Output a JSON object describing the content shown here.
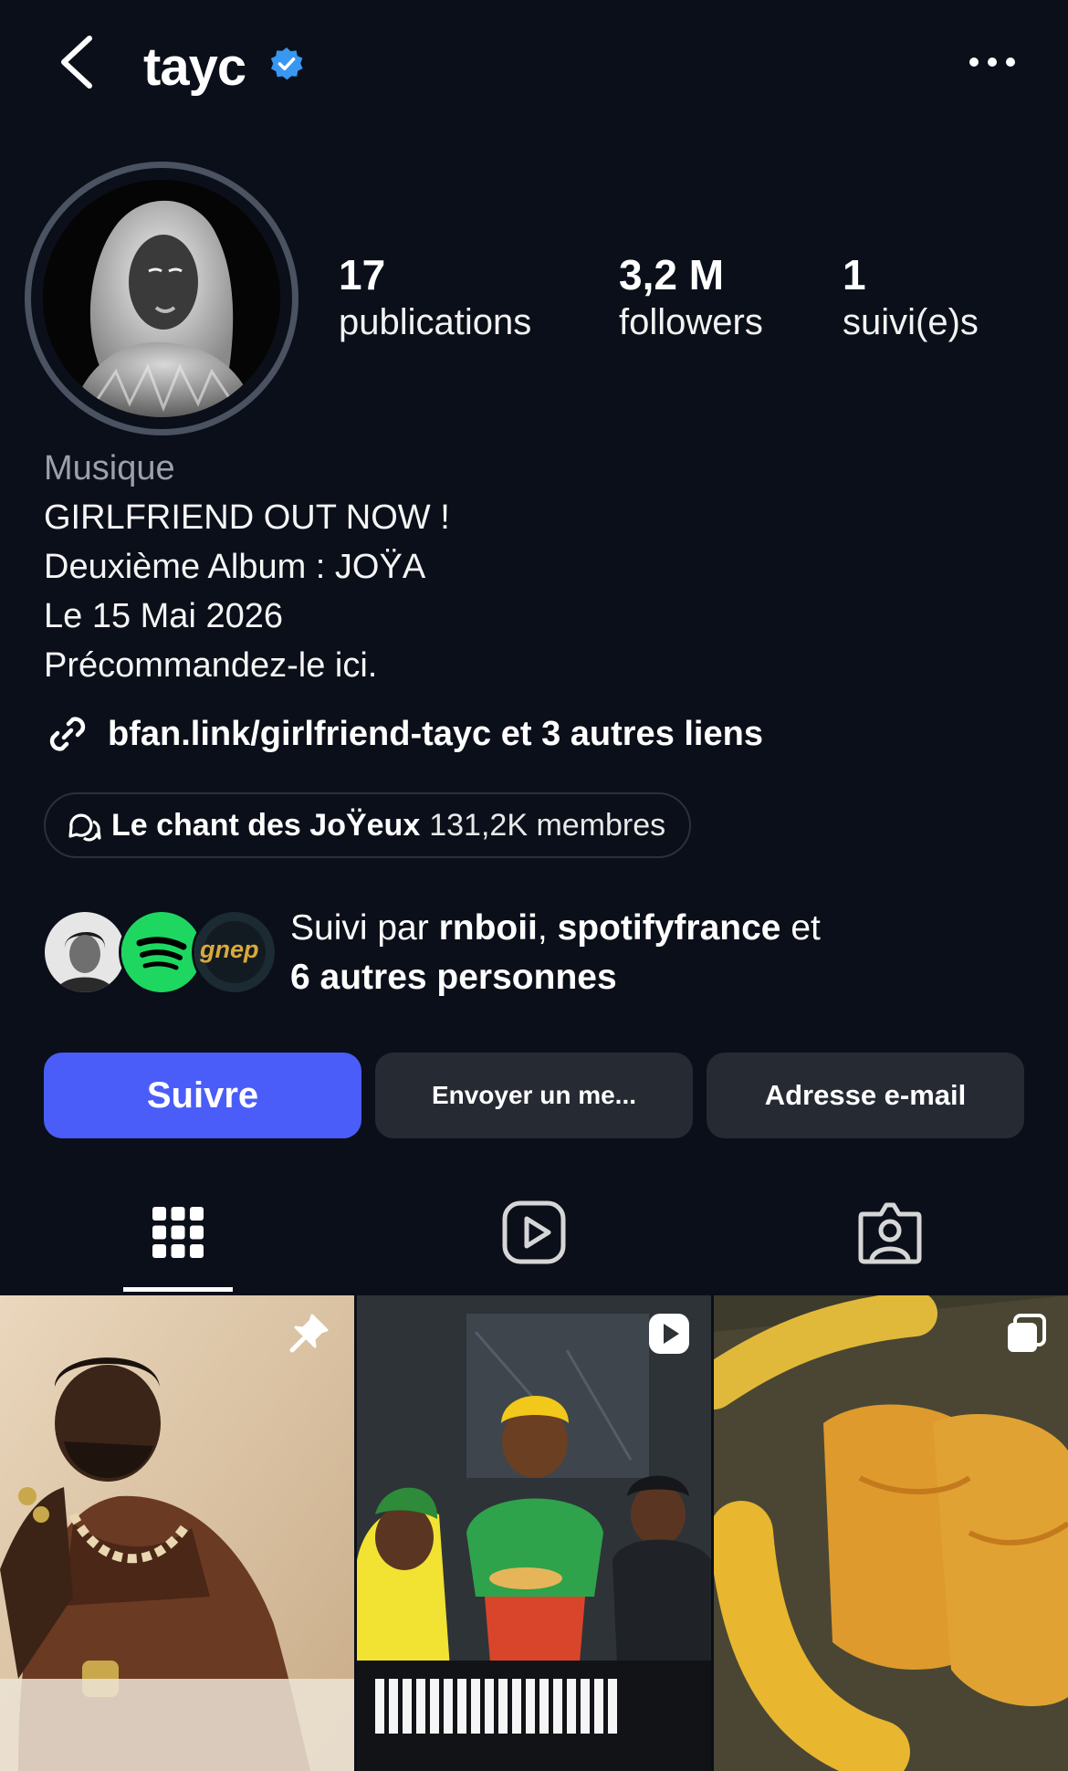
{
  "header": {
    "username": "tayc",
    "icons": {
      "back": "chevron-left-icon",
      "verified": "verified-badge-icon",
      "more": "more-horizontal-icon"
    }
  },
  "stats": [
    {
      "value": "17",
      "label": "publications"
    },
    {
      "value": "3,2 M",
      "label": "followers"
    },
    {
      "value": "1",
      "label": "suivi(e)s"
    }
  ],
  "bio": {
    "category": "Musique",
    "lines": [
      "GIRLFRIEND OUT NOW !",
      "Deuxième Album : JOŸA",
      "Le 15 Mai 2026",
      "Précommandez-le ici."
    ],
    "link_text": "bfan.link/girlfriend-tayc et 3 autres liens"
  },
  "channel": {
    "name": "Le chant des JoŸeux",
    "members": "131,2K membres"
  },
  "followed_by": {
    "prefix": "Suivi par ",
    "user1": "rnboii",
    "sep": ", ",
    "user2": "spotifyfrance",
    "suffix": " et",
    "others": "6 autres personnes",
    "avatar3_text": "gnep"
  },
  "buttons": {
    "follow": "Suivre",
    "message": "Envoyer un me...",
    "email": "Adresse e-mail"
  },
  "tabs": [
    "posts-grid",
    "reels",
    "tagged"
  ],
  "accent": "#4a5df9",
  "background": "#0b0f19"
}
